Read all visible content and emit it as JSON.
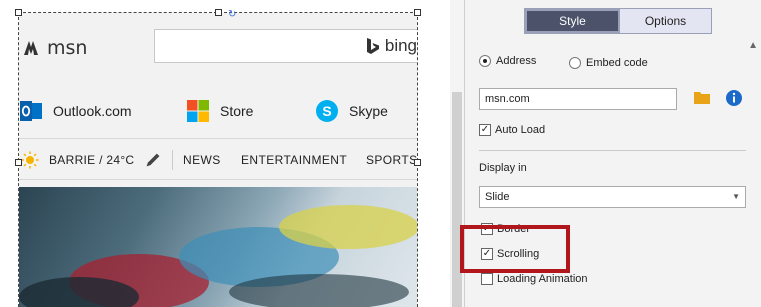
{
  "webpage": {
    "logo_text": "msn",
    "search": {
      "brand": "bing",
      "value": ""
    },
    "services": [
      {
        "label": "Outlook.com",
        "icon": "outlook-icon",
        "color": "#0072c6"
      },
      {
        "label": "Store",
        "icon": "windows-store-icon",
        "color": "#f25022"
      },
      {
        "label": "Skype",
        "icon": "skype-icon",
        "color": "#00aff0"
      }
    ],
    "weather": {
      "location": "BARRIE / 24°C",
      "icon": "sun-icon"
    },
    "nav": [
      "NEWS",
      "ENTERTAINMENT",
      "SPORTS"
    ]
  },
  "panel": {
    "tabs": [
      {
        "label": "Style",
        "active": true
      },
      {
        "label": "Options",
        "active": false
      }
    ],
    "source": {
      "options": [
        {
          "label": "Address",
          "checked": true
        },
        {
          "label": "Embed code",
          "checked": false
        }
      ],
      "address_value": "msn.com"
    },
    "auto_load": {
      "label": "Auto Load",
      "checked": true
    },
    "display_in": {
      "label": "Display in",
      "selected": "Slide"
    },
    "border": {
      "label": "Border",
      "checked": true
    },
    "scrolling": {
      "label": "Scrolling",
      "checked": true
    },
    "loading_animation": {
      "label": "Loading Animation",
      "checked": false
    },
    "colors": {
      "tab_active": "#4b5269",
      "highlight": "#b0161c",
      "folder": "#e8a317",
      "info": "#1b6ac9"
    }
  }
}
